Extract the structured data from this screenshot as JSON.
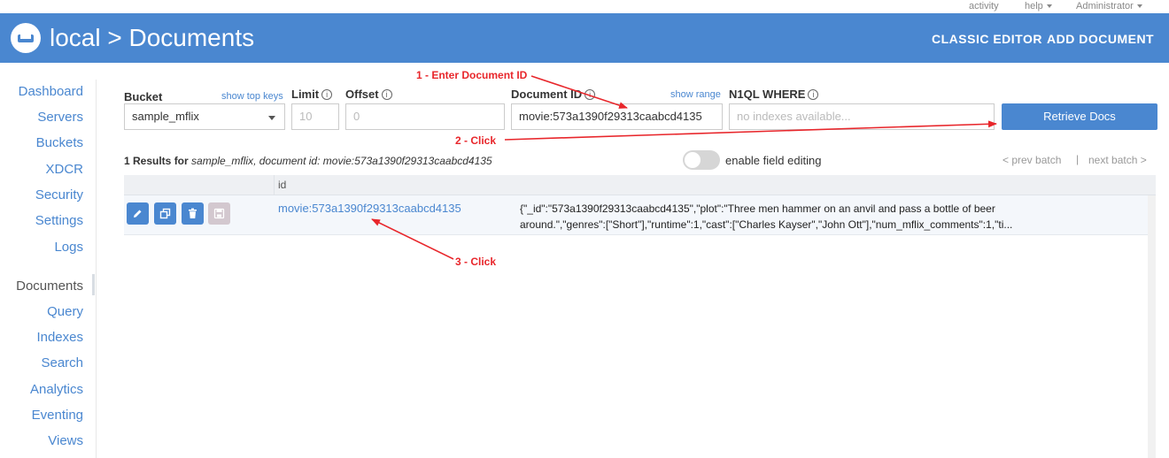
{
  "topbar": {
    "activity": "activity",
    "help": "help",
    "user": "Administrator"
  },
  "header": {
    "title": "local > Documents",
    "classic_editor": "CLASSIC EDITOR",
    "add_document": "ADD DOCUMENT",
    "brand_color": "#4a87d0"
  },
  "sidebar": {
    "items": [
      {
        "label": "Dashboard"
      },
      {
        "label": "Servers"
      },
      {
        "label": "Buckets"
      },
      {
        "label": "XDCR"
      },
      {
        "label": "Security"
      },
      {
        "label": "Settings"
      },
      {
        "label": "Logs"
      },
      {
        "label": "Documents"
      },
      {
        "label": "Query"
      },
      {
        "label": "Indexes"
      },
      {
        "label": "Search"
      },
      {
        "label": "Analytics"
      },
      {
        "label": "Eventing"
      },
      {
        "label": "Views"
      }
    ],
    "active": "Documents"
  },
  "controls": {
    "bucket_label": "Bucket",
    "show_top_keys": "show top keys",
    "bucket_value": "sample_mflix",
    "limit_label": "Limit",
    "limit_value": "10",
    "offset_label": "Offset",
    "offset_value": "0",
    "doc_id_label": "Document ID",
    "show_range": "show range",
    "doc_id_value": "movie:573a1390f29313caabcd4135",
    "n1ql_label": "N1QL WHERE",
    "n1ql_placeholder": "no indexes available...",
    "retrieve_button": "Retrieve Docs",
    "info_icon": "i"
  },
  "results": {
    "prefix": "1 Results for ",
    "bucket": "sample_mflix",
    "middle": ", document id: ",
    "doc_id": "movie:573a1390f29313caabcd4135",
    "toggle_label": "enable field editing",
    "prev_batch": "< prev batch",
    "separator": "|",
    "next_batch": "next batch >"
  },
  "table": {
    "column_id": "id",
    "rows": [
      {
        "id": "movie:573a1390f29313caabcd4135",
        "json_line1": "{\"_id\":\"573a1390f29313caabcd4135\",\"plot\":\"Three men hammer on an anvil and pass a bottle of beer",
        "json_line2": "around.\",\"genres\":[\"Short\"],\"runtime\":1,\"cast\":[\"Charles Kayser\",\"John Ott\"],\"num_mflix_comments\":1,\"ti..."
      }
    ]
  },
  "annotations": {
    "step1": "1 - Enter Document ID",
    "step2": "2 - Click",
    "step3": "3 - Click",
    "color": "#e8262b"
  }
}
